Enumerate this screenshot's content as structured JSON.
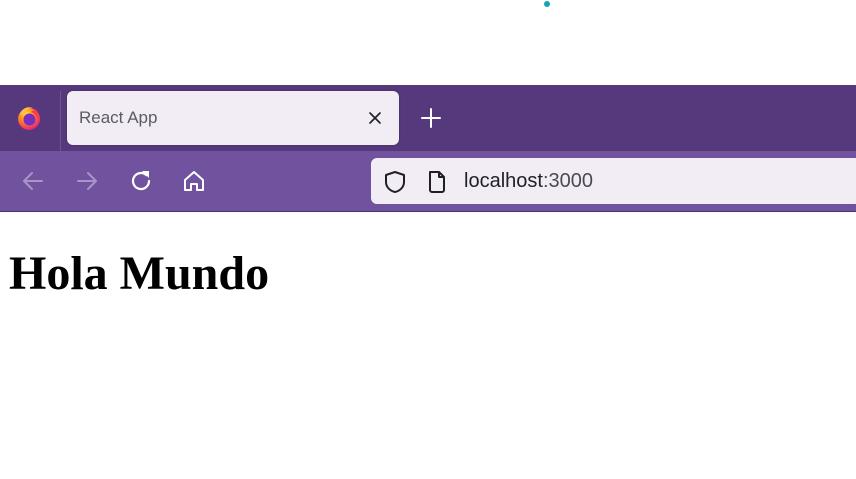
{
  "browser": {
    "app_icon": "firefox-logo-icon",
    "tab": {
      "title": "React App",
      "close_icon": "close-icon"
    },
    "new_tab_icon": "plus-icon",
    "toolbar": {
      "back_icon": "arrow-left-icon",
      "forward_icon": "arrow-right-icon",
      "reload_icon": "reload-icon",
      "home_icon": "home-icon"
    },
    "urlbar": {
      "security_icon": "shield-icon",
      "page_icon": "page-icon",
      "host": "localhost",
      "port": ":3000"
    }
  },
  "page": {
    "heading": "Hola Mundo"
  },
  "colors": {
    "tabstrip": "#56387c",
    "navbar": "#71529f",
    "tab_bg": "#f2ecf5",
    "top_dot": "#16a2b8"
  }
}
